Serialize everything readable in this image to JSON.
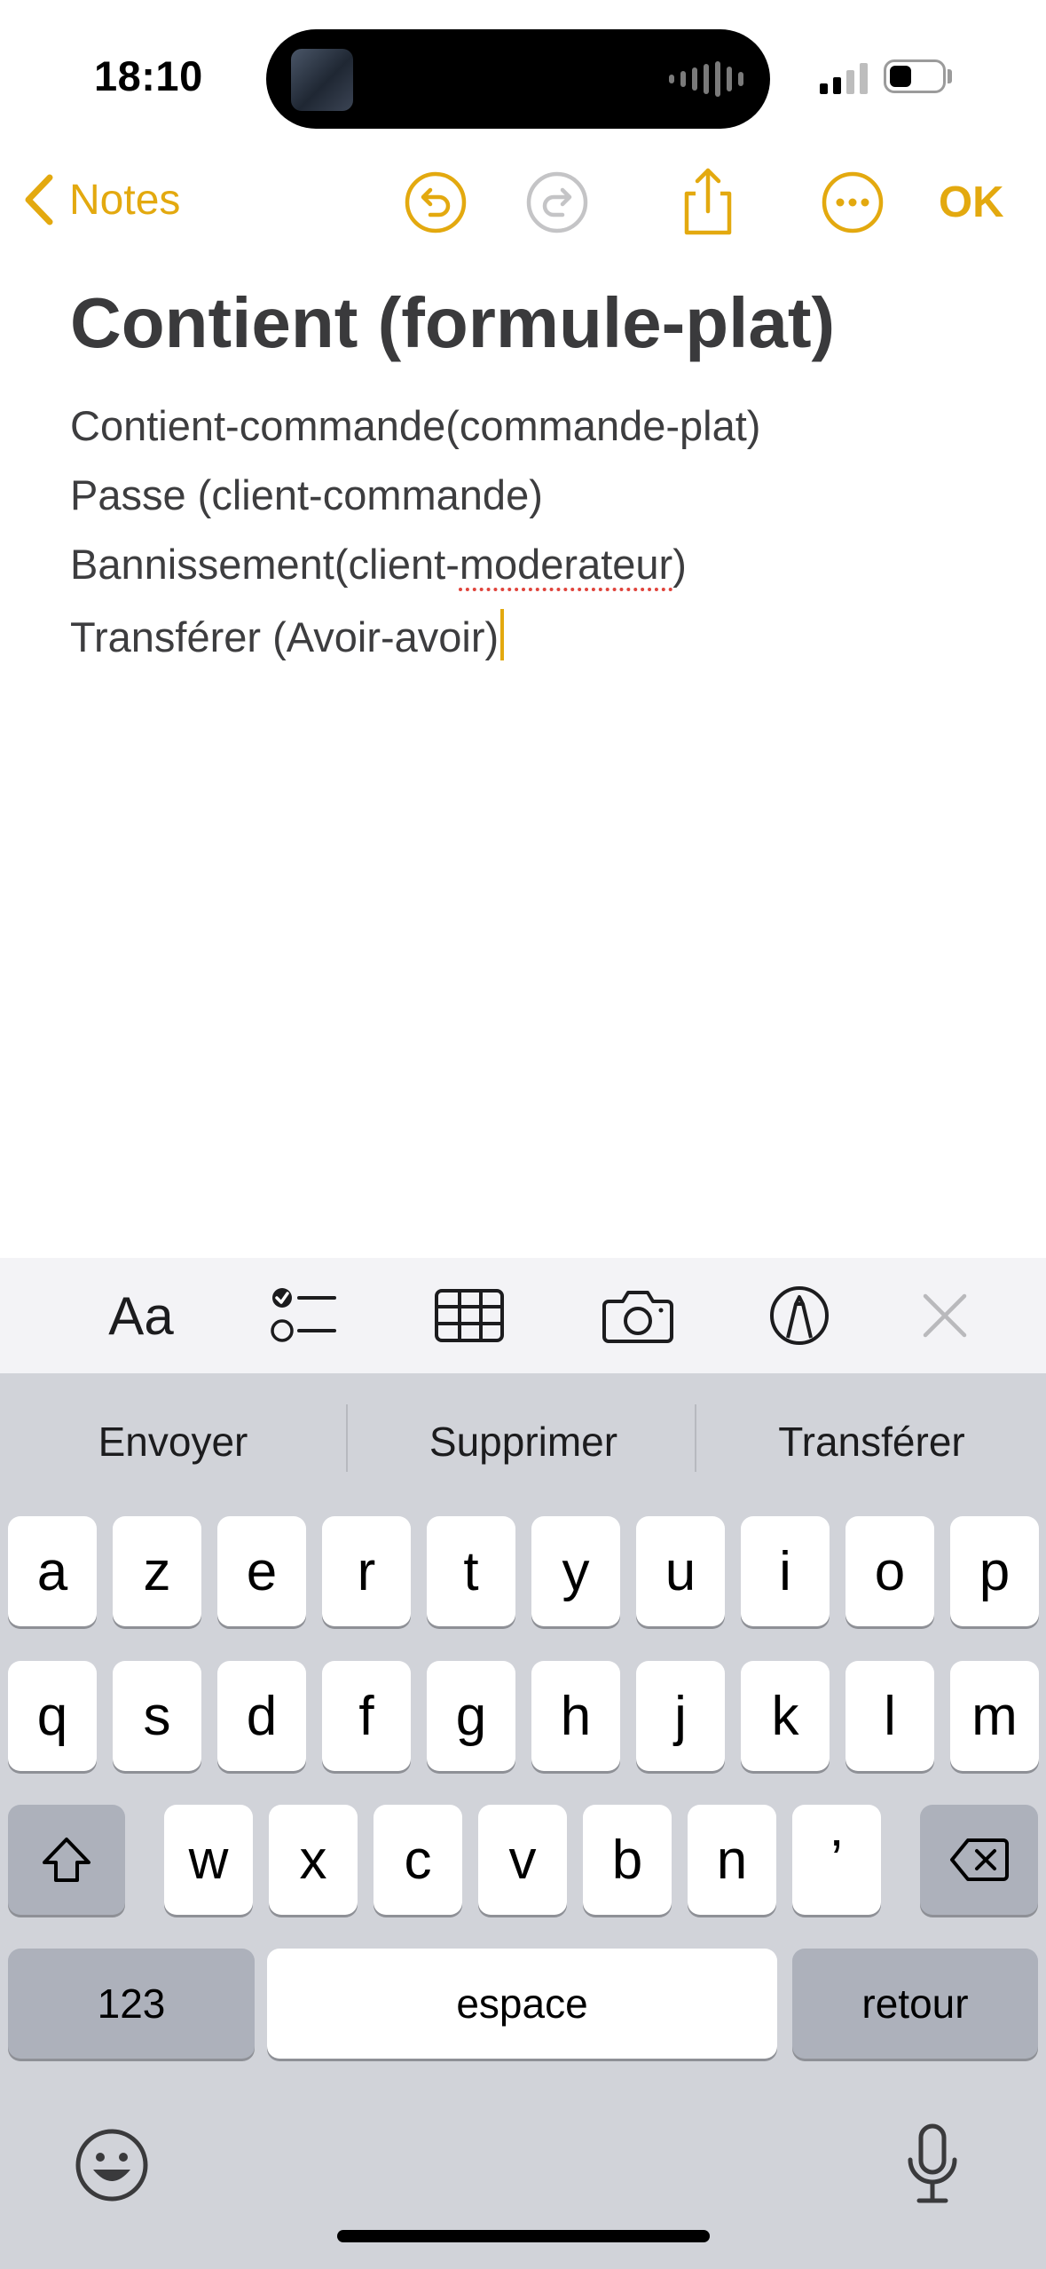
{
  "status_bar": {
    "time": "18:10"
  },
  "nav": {
    "back_label": "Notes",
    "done_label": "OK",
    "accent_color": "#e3a90f",
    "icons": [
      "undo-icon",
      "redo-icon",
      "share-icon",
      "more-icon"
    ]
  },
  "note": {
    "title": "Contient (formule-plat)",
    "lines": [
      "Contient-commande(commande-plat)",
      "Passe (client-commande)",
      "Bannissement(client-",
      "moderateur",
      ")",
      "Transférer (Avoir-avoir)"
    ]
  },
  "format_toolbar": {
    "text_style_label": "Aa",
    "icons": [
      "checklist-icon",
      "table-icon",
      "camera-icon",
      "markup-icon",
      "close-icon"
    ]
  },
  "keyboard": {
    "suggestions": [
      "Envoyer",
      "Supprimer",
      "Transférer"
    ],
    "row1": [
      "a",
      "z",
      "e",
      "r",
      "t",
      "y",
      "u",
      "i",
      "o",
      "p"
    ],
    "row2": [
      "q",
      "s",
      "d",
      "f",
      "g",
      "h",
      "j",
      "k",
      "l",
      "m"
    ],
    "row3": [
      "w",
      "x",
      "c",
      "v",
      "b",
      "n",
      "’"
    ],
    "numbers_label": "123",
    "space_label": "espace",
    "return_label": "retour"
  }
}
